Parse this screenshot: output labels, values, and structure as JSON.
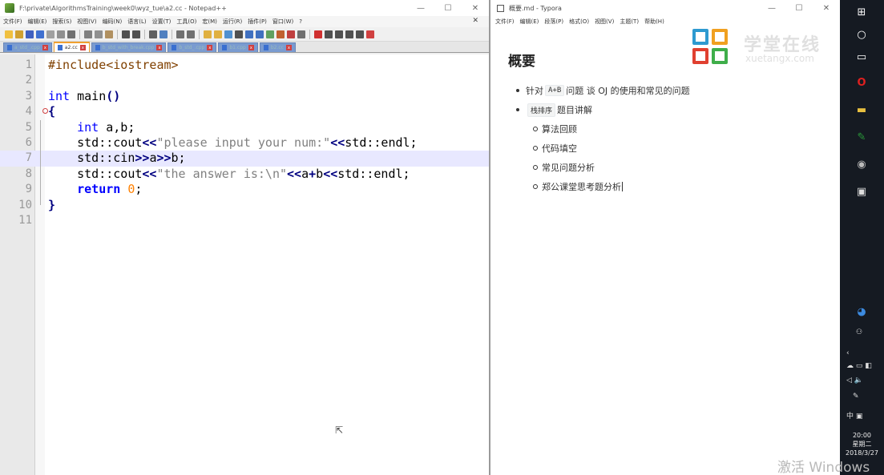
{
  "notepad": {
    "title": "F:\\private\\AlgorithmsTraining\\week0\\wyz_tue\\a2.cc - Notepad++",
    "window_controls": [
      "—",
      "☐",
      "✕"
    ],
    "menu": [
      "文件(F)",
      "编辑(E)",
      "搜索(S)",
      "视图(V)",
      "编码(N)",
      "语言(L)",
      "设置(T)",
      "工具(O)",
      "宏(M)",
      "运行(R)",
      "插件(P)",
      "窗口(W)",
      "?"
    ],
    "tabs": [
      {
        "label": "a_std_.cpp",
        "active": false
      },
      {
        "label": "a2.cc",
        "active": true
      },
      {
        "label": "b_std_with_break.cpp",
        "active": false
      },
      {
        "label": "b_std_.cpp",
        "active": false
      },
      {
        "label": "b1.cpp",
        "active": false
      },
      {
        "label": "b2.cc",
        "active": false
      }
    ],
    "line_numbers": [
      "1",
      "2",
      "3",
      "4",
      "5",
      "6",
      "7",
      "8",
      "9",
      "10",
      "11"
    ],
    "current_line": 7,
    "code_tokens": {
      "l1_pre": "#include<iostream>",
      "l3_kw": "int",
      "l3_rest": " main",
      "l3_paren": "()",
      "l4_brace": "{",
      "l5_kw": "int",
      "l5_rest": " a,b;",
      "l6_a": "std::cout",
      "l6_op1": "<<",
      "l6_str": "\"please input your num:\"",
      "l6_op2": "<<",
      "l6_b": "std::endl;",
      "l7_a": "std::cin",
      "l7_op1": ">>",
      "l7_b": "a",
      "l7_op2": ">>",
      "l7_c": "b;",
      "l8_a": "std::cout",
      "l8_op1": "<<",
      "l8_str": "\"the answer is:\\n\"",
      "l8_op2": "<<",
      "l8_b": "a",
      "l8_op3": "+",
      "l8_c": "b",
      "l8_op4": "<<",
      "l8_d": "std::endl;",
      "l9_kw": "return",
      "l9_num": "0",
      "l9_end": ";",
      "l10_brace": "}"
    }
  },
  "typora": {
    "title": "概要.md - Typora",
    "window_controls": [
      "—",
      "☐",
      "✕"
    ],
    "menu": [
      "文件(F)",
      "编辑(E)",
      "段落(P)",
      "格式(O)",
      "视图(V)",
      "主题(T)",
      "帮助(H)"
    ],
    "heading": "概要",
    "items": [
      {
        "pre": "针对",
        "code": "A+B",
        "post": "问题 谈 OJ 的使用和常见的问题"
      },
      {
        "pre": "",
        "code": "栈排序",
        "post": "题目讲解"
      }
    ],
    "subitems": [
      "算法回顾",
      "代码填空",
      "常见问题分析",
      "郑公课堂思考题分析"
    ]
  },
  "logo": {
    "name": "学堂在线",
    "domain": "xuetangx.com",
    "colors": [
      "#2e9ad0",
      "#f0a020",
      "#e04030",
      "#3fae4a"
    ]
  },
  "taskbar": {
    "time": "20:00",
    "weekday": "星期二",
    "date": "2018/3/27",
    "ime": "中",
    "accent_colors": [
      "#e02020",
      "#2a9a3a",
      "#e8c040"
    ]
  },
  "watermark": "激活 Windows"
}
